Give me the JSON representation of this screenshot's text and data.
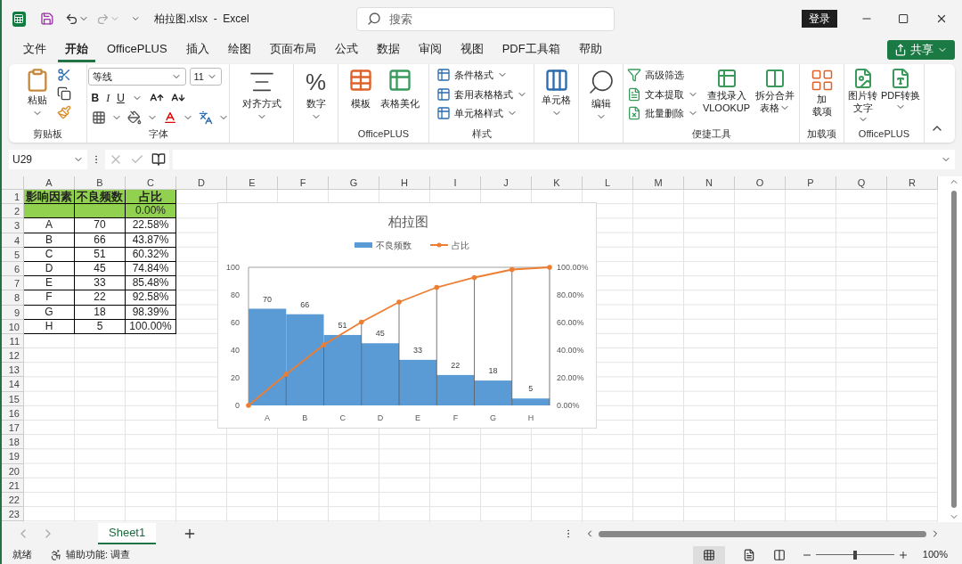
{
  "title_bar": {
    "document_title": "柏拉图.xlsx  -  Excel",
    "search_placeholder": "搜索",
    "sign_in": "登录"
  },
  "menu_tabs": [
    {
      "label": "文件",
      "selected": false
    },
    {
      "label": "开始",
      "selected": true
    },
    {
      "label": "OfficePLUS",
      "selected": false
    },
    {
      "label": "插入",
      "selected": false
    },
    {
      "label": "绘图",
      "selected": false
    },
    {
      "label": "页面布局",
      "selected": false
    },
    {
      "label": "公式",
      "selected": false
    },
    {
      "label": "数据",
      "selected": false
    },
    {
      "label": "审阅",
      "selected": false
    },
    {
      "label": "视图",
      "selected": false
    },
    {
      "label": "PDF工具箱",
      "selected": false
    },
    {
      "label": "帮助",
      "selected": false
    }
  ],
  "share_button": "共享",
  "ribbon": {
    "clipboard": {
      "paste": "粘贴",
      "label": "剪贴板"
    },
    "font": {
      "family": "等线",
      "size": "11",
      "bold": "B",
      "italic": "I",
      "underline": "U",
      "label": "字体"
    },
    "alignment": {
      "label": "对齐方式"
    },
    "number": {
      "symbol": "%",
      "label": "数字"
    },
    "officeplus": {
      "buttons": [
        "模板",
        "表格美化"
      ],
      "label": "OfficePLUS"
    },
    "styles": {
      "buttons": [
        "条件格式",
        "套用表格格式",
        "单元格样式"
      ],
      "label": "样式"
    },
    "cells": {
      "label": "单元格"
    },
    "editing": {
      "label": "编辑"
    },
    "quick_tools": {
      "small_buttons": [
        {
          "label": "高级筛选",
          "dropdown": false
        },
        {
          "label": "文本提取",
          "dropdown": true
        },
        {
          "label": "批量删除",
          "dropdown": true
        }
      ],
      "large_buttons": [
        {
          "lines": [
            "查找录入",
            "VLOOKUP"
          ],
          "dropdown": false
        },
        {
          "lines": [
            "拆分合并",
            "表格"
          ],
          "dropdown": true
        }
      ],
      "label": "便捷工具"
    },
    "addins": {
      "lines": [
        "加",
        "载项"
      ],
      "label": "加载项"
    },
    "officeplus_tools": {
      "buttons": [
        {
          "lines": [
            "图片转",
            "文字"
          ]
        },
        {
          "lines": [
            "PDF转换"
          ]
        }
      ],
      "label": "OfficePLUS"
    }
  },
  "formula_bar": {
    "name_box": "U29"
  },
  "sheet": {
    "columns": [
      "A",
      "B",
      "C",
      "D",
      "E",
      "F",
      "G",
      "H",
      "I",
      "J",
      "K",
      "L",
      "M",
      "N",
      "O",
      "P",
      "Q",
      "R"
    ],
    "rows": [
      "1",
      "2",
      "3",
      "4",
      "5",
      "6",
      "7",
      "8",
      "9",
      "10",
      "11",
      "12",
      "13",
      "14",
      "15",
      "16",
      "17",
      "18",
      "19",
      "20",
      "21",
      "22",
      "23"
    ],
    "table": [
      {
        "kind": "header",
        "color": "#92d050",
        "cells": [
          "影响因素",
          "不良频数",
          "占比"
        ]
      },
      {
        "kind": "data",
        "color": "#92d050",
        "cells": [
          null,
          null,
          "0.00%"
        ]
      },
      {
        "kind": "data",
        "cells": [
          "A",
          "70",
          "22.58%"
        ]
      },
      {
        "kind": "data",
        "cells": [
          "B",
          "66",
          "43.87%"
        ]
      },
      {
        "kind": "data",
        "cells": [
          "C",
          "51",
          "60.32%"
        ]
      },
      {
        "kind": "data",
        "cells": [
          "D",
          "45",
          "74.84%"
        ]
      },
      {
        "kind": "data",
        "cells": [
          "E",
          "33",
          "85.48%"
        ]
      },
      {
        "kind": "data",
        "cells": [
          "F",
          "22",
          "92.58%"
        ]
      },
      {
        "kind": "data",
        "cells": [
          "G",
          "18",
          "98.39%"
        ]
      },
      {
        "kind": "data",
        "cells": [
          "H",
          "5",
          "100.00%"
        ]
      }
    ]
  },
  "chart": {
    "chart_data": {
      "type": "bar",
      "title": "柏拉图",
      "categories": [
        "A",
        "B",
        "C",
        "D",
        "E",
        "F",
        "G",
        "H"
      ],
      "series": [
        {
          "name": "不良频数",
          "color": "#5b9bd5",
          "values": [
            70,
            66,
            51,
            45,
            33,
            22,
            18,
            5
          ]
        }
      ],
      "ylim": [
        0,
        100
      ],
      "yticks": [
        0,
        20,
        40,
        60,
        80,
        100
      ],
      "data_labels": true
    },
    "line_overlay": {
      "chart_data": {
        "type": "line",
        "categories": [
          null,
          null,
          null,
          null,
          null,
          null,
          null,
          null,
          null
        ],
        "grid": true,
        "series": [
          {
            "name": "占比",
            "color": "#ed7d31",
            "values": [
              0,
              0.2258,
              0.4387,
              0.6032,
              0.7484,
              0.8548,
              0.9258,
              0.9839,
              1.0
            ]
          }
        ],
        "ylim": [
          0,
          1
        ],
        "yticks": [
          {
            "value": 0,
            "label": "0.00%"
          },
          {
            "value": 0.2,
            "label": "20.00%"
          },
          {
            "value": 0.4,
            "label": "40.00%"
          },
          {
            "value": 0.6,
            "label": "60.00%"
          },
          {
            "value": 0.8,
            "label": "80.00%"
          },
          {
            "value": 1,
            "label": "100.00%"
          }
        ]
      }
    }
  },
  "sheet_tabs": [
    {
      "label": "Sheet1",
      "selected": true
    }
  ],
  "status_bar": {
    "mode": "就绪",
    "accessibility": "辅助功能: 调查",
    "zoom": "100%",
    "level": 0.5
  }
}
